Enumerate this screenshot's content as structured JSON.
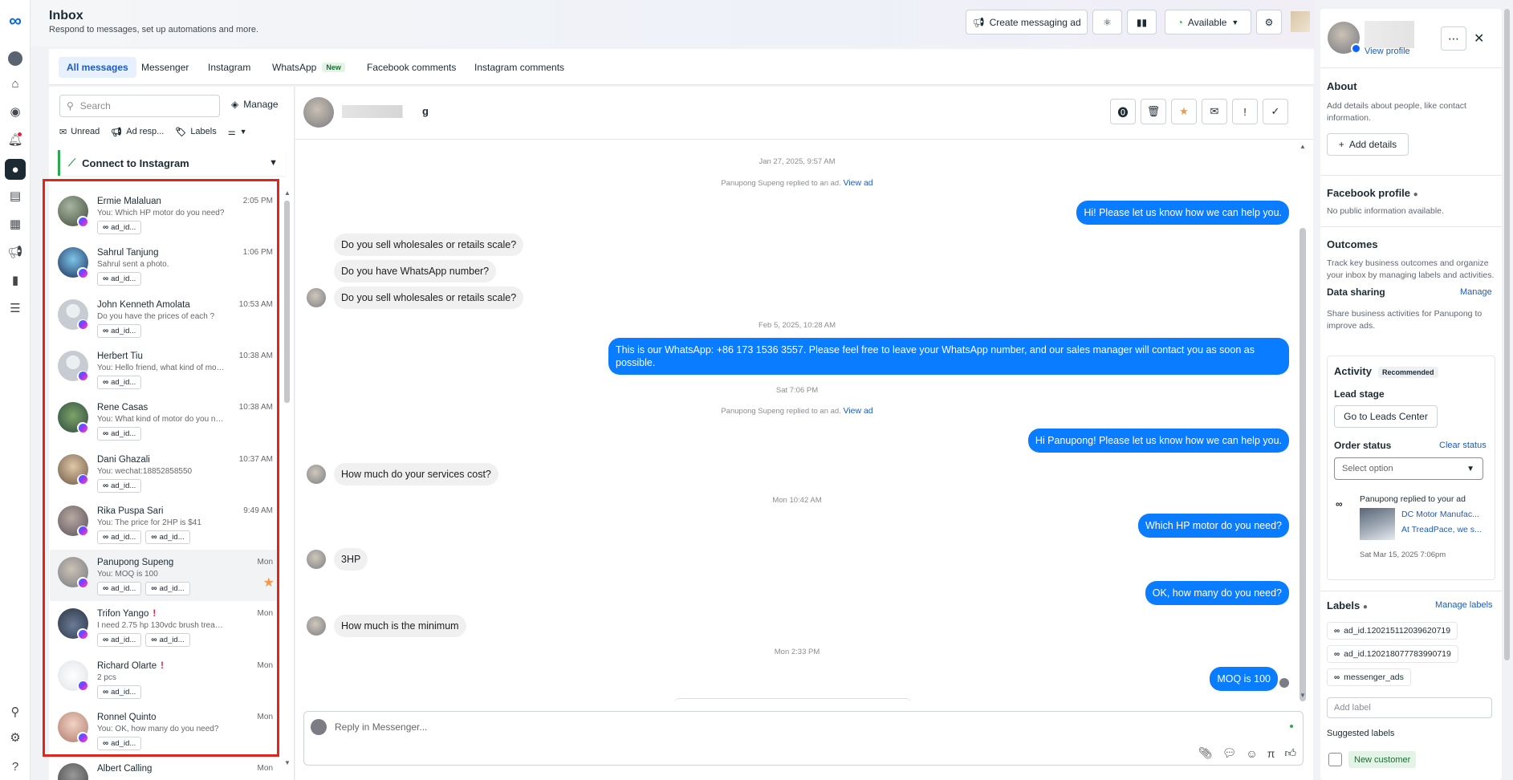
{
  "header": {
    "title": "Inbox",
    "subtitle": "Respond to messages, set up automations and more.",
    "create_ad": "Create messaging ad",
    "status": "Available"
  },
  "tabs": [
    {
      "label": "All messages"
    },
    {
      "label": "Messenger"
    },
    {
      "label": "Instagram"
    },
    {
      "label": "WhatsApp",
      "badge": "New"
    },
    {
      "label": "Facebook comments"
    },
    {
      "label": "Instagram comments"
    }
  ],
  "list": {
    "search_placeholder": "Search",
    "manage": "Manage",
    "filters": {
      "unread": "Unread",
      "ad": "Ad resp...",
      "labels": "Labels"
    },
    "connect": "Connect to Instagram",
    "conversations": [
      {
        "name": "Ermie Malaluan",
        "preview": "You: Which HP motor do you need?",
        "time": "2:05 PM",
        "labels": [
          "ad_id..."
        ]
      },
      {
        "name": "Sahrul Tanjung",
        "preview": "Sahrul sent a photo.",
        "time": "1:06 PM",
        "labels": [
          "ad_id..."
        ]
      },
      {
        "name": "John Kenneth Amolata",
        "preview": "Do you have the prices of each ?",
        "time": "10:53 AM",
        "labels": [
          "ad_id..."
        ]
      },
      {
        "name": "Herbert Tiu",
        "preview": "You: Hello friend, what kind of motor do...",
        "time": "10:38 AM",
        "labels": [
          "ad_id..."
        ]
      },
      {
        "name": "Rene Casas",
        "preview": "You: What kind of motor do you need?",
        "time": "10:38 AM",
        "labels": [
          "ad_id..."
        ]
      },
      {
        "name": "Dani Ghazali",
        "preview": "You: wechat:18852858550",
        "time": "10:37 AM",
        "labels": [
          "ad_id..."
        ]
      },
      {
        "name": "Rika Puspa Sari",
        "preview": "You: The price for 2HP is $41",
        "time": "9:49 AM",
        "labels": [
          "ad_id...",
          "ad_id..."
        ]
      },
      {
        "name": "Panupong Supeng",
        "preview": "You: MOQ is 100",
        "time": "Mon",
        "labels": [
          "ad_id...",
          "ad_id..."
        ]
      },
      {
        "name": "Trifon Yango",
        "preview": "I need 2.75 hp 130vdc brush treadmil...",
        "time": "Mon",
        "labels": [
          "ad_id...",
          "ad_id..."
        ],
        "warn": "!"
      },
      {
        "name": "Richard Olarte",
        "preview": "2 pcs",
        "time": "Mon",
        "labels": [
          "ad_id..."
        ],
        "warn": "!"
      },
      {
        "name": "Ronnel Quinto",
        "preview": "You: OK, how many do you need?",
        "time": "Mon",
        "labels": [
          "ad_id..."
        ]
      },
      {
        "name": "Albert Calling",
        "preview": "",
        "time": "Mon",
        "labels": []
      }
    ]
  },
  "chat": {
    "name": "g",
    "ts1": "Jan 27, 2025, 9:57 AM",
    "sys1": "Panupong Supeng replied to an ad.",
    "view_ad": "View ad",
    "out1": "Hi! Please let us know how we can help you.",
    "in1": "Do you sell wholesales or retails scale?",
    "in2": "Do you have WhatsApp number?",
    "in3": "Do you sell wholesales or retails scale?",
    "ts2": "Feb 5, 2025, 10:28 AM",
    "out2": "This is our WhatsApp: +86 173 1536 3557. Please feel free to leave your WhatsApp number, and our sales manager will contact you as soon as possible.",
    "ts3": "Sat 7:06 PM",
    "sys2": "Panupong Supeng replied to an ad.",
    "out3": "Hi Panupong! Please let us know how we can help you.",
    "in4": "How much do your services cost?",
    "ts4": "Mon 10:42 AM",
    "out4": "Which HP motor do you need?",
    "in5": "3HP",
    "out5": "OK, how many do you need?",
    "in6": "How much is the minimum",
    "ts5": "Mon 2:33 PM",
    "out6": "MOQ is 100",
    "reply_placeholder": "Reply in Messenger..."
  },
  "profile": {
    "view_profile": "View profile",
    "about_title": "About",
    "about_text": "Add details about people, like contact information.",
    "add_details": "Add details",
    "fb_title": "Facebook profile",
    "fb_text": "No public information available.",
    "outcomes_title": "Outcomes",
    "outcomes_text": "Track key business outcomes and organize your inbox by managing labels and activities.",
    "data_sharing": "Data sharing",
    "manage": "Manage",
    "data_text": "Share business activities for Panupong to improve ads.",
    "activity": "Activity",
    "recommended": "Recommended",
    "lead_stage": "Lead stage",
    "leads_btn": "Go to Leads Center",
    "order_status": "Order status",
    "clear_status": "Clear status",
    "select_option": "Select option",
    "replied": "Panupong replied to your ad",
    "ad_title": "DC Motor Manufac...",
    "ad_sub": "At TreadPace, we s...",
    "ad_time": "Sat Mar 15, 2025 7:06pm",
    "labels_title": "Labels",
    "manage_labels": "Manage labels",
    "labels": [
      "ad_id.120215112039620719",
      "ad_id.120218077783990719",
      "messenger_ads"
    ],
    "add_label": "Add label",
    "suggested": "Suggested labels",
    "new_customer": "New customer"
  }
}
